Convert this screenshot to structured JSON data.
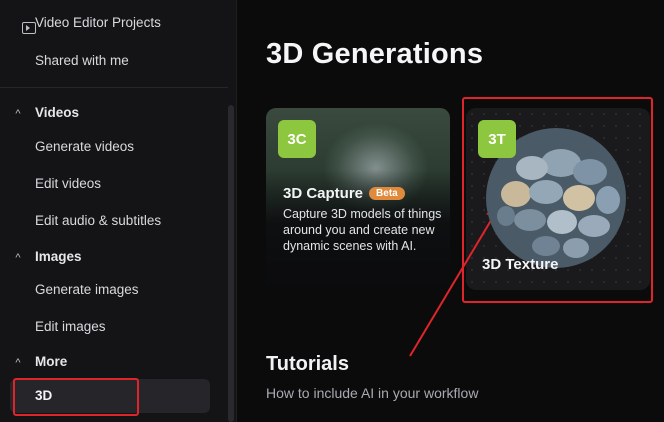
{
  "sidebar": {
    "items": {
      "video_editor_projects": "Video Editor Projects",
      "shared_with_me": "Shared with me",
      "generate_videos": "Generate videos",
      "edit_videos": "Edit videos",
      "edit_audio": "Edit audio & subtitles",
      "generate_images": "Generate images",
      "edit_images": "Edit images",
      "three_d": "3D"
    },
    "sections": {
      "videos": "Videos",
      "images": "Images",
      "more": "More"
    },
    "chevron": "^"
  },
  "main": {
    "title": "3D Generations",
    "cards": [
      {
        "badge": "3C",
        "title": "3D Capture",
        "tag": "Beta",
        "description": "Capture 3D models of things around you and create new dynamic scenes with AI."
      },
      {
        "badge": "3T",
        "title": "3D Texture"
      }
    ],
    "tutorials": {
      "title": "Tutorials",
      "subtitle": "How to include AI in your workflow"
    }
  },
  "colors": {
    "badge_green": "#8dc63f",
    "beta_orange": "#e08a3c",
    "annotation_red": "#e0242b"
  }
}
